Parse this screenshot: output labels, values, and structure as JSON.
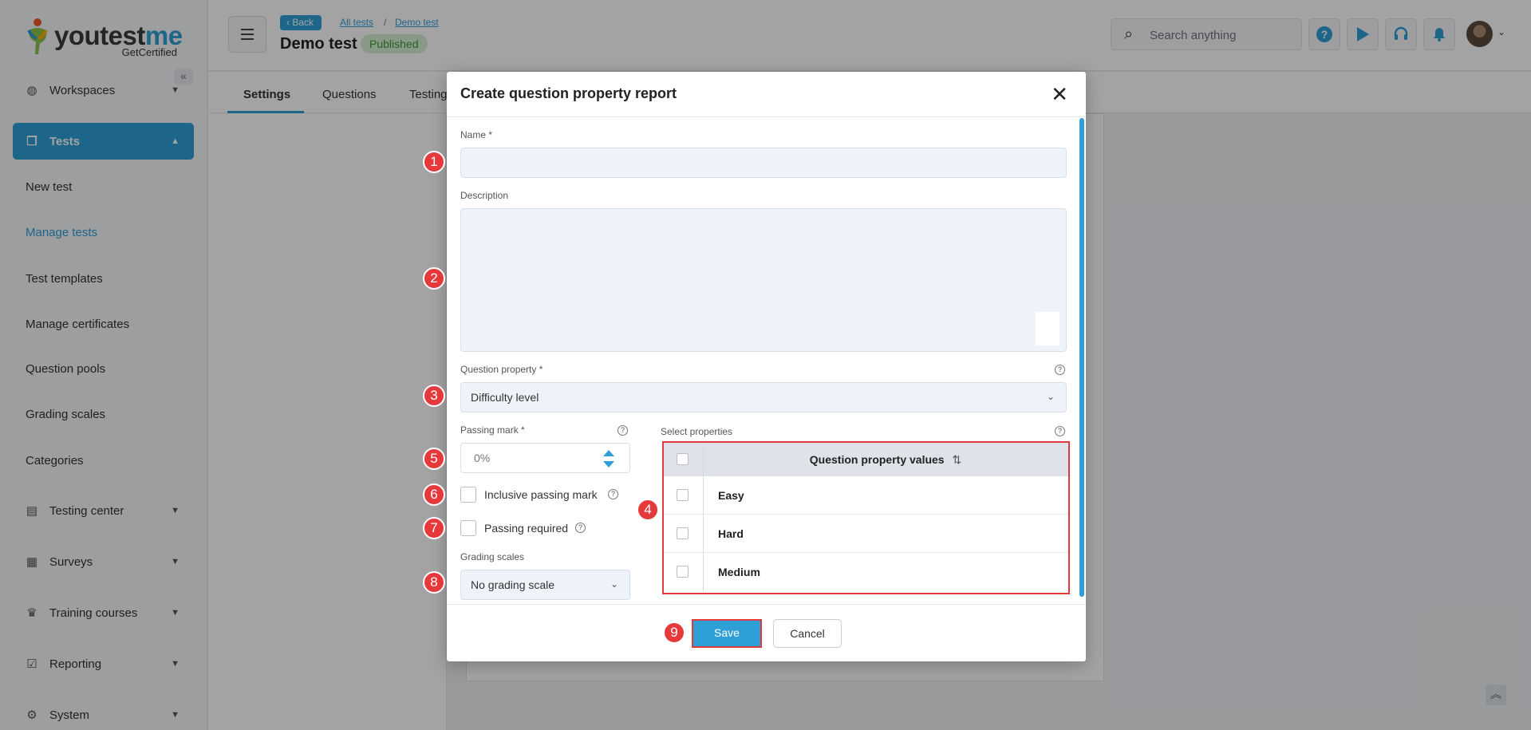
{
  "brand": {
    "logo_text_main": "youtest",
    "logo_text_me": "me",
    "logo_sub": "GetCertified"
  },
  "sidebar": {
    "collapse_label": "«",
    "items": [
      {
        "label": "Workspaces",
        "icon": "globe-icon"
      },
      {
        "label": "Tests",
        "icon": "copy-icon"
      },
      {
        "label": "Testing center",
        "icon": "monitor-icon"
      },
      {
        "label": "Surveys",
        "icon": "list-icon"
      },
      {
        "label": "Training courses",
        "icon": "trophy-icon"
      },
      {
        "label": "Reporting",
        "icon": "checkbox-icon"
      },
      {
        "label": "System",
        "icon": "gear-icon"
      }
    ],
    "sub_items": [
      "New test",
      "Manage tests",
      "Test templates",
      "Manage certificates",
      "Question pools",
      "Grading scales",
      "Categories"
    ]
  },
  "header": {
    "back_label": "Back",
    "breadcrumb": [
      "All tests",
      "Demo test"
    ],
    "breadcrumb_sep": "/",
    "title": "Demo test",
    "status": "Published",
    "search_placeholder": "Search anything"
  },
  "tabs": [
    "Settings",
    "Questions",
    "Testing"
  ],
  "modal": {
    "title": "Create question property report",
    "name_label": "Name *",
    "name_value": "",
    "description_label": "Description",
    "description_value": "",
    "question_property_label": "Question property *",
    "question_property_value": "Difficulty level",
    "passing_mark_label": "Passing mark *",
    "passing_mark_value": "0%",
    "inclusive_label": "Inclusive passing mark",
    "passing_required_label": "Passing required",
    "grading_scales_label": "Grading scales",
    "grading_scales_value": "No grading scale",
    "select_properties_label": "Select properties",
    "table_header": "Question property values",
    "table_rows": [
      "Easy",
      "Hard",
      "Medium"
    ],
    "save_label": "Save",
    "cancel_label": "Cancel"
  },
  "annotations": [
    "1",
    "2",
    "3",
    "4",
    "5",
    "6",
    "7",
    "8",
    "9"
  ],
  "colors": {
    "accent": "#2f9fd8",
    "highlight": "#e03a3a",
    "published_bg": "#d6f0d4",
    "published_text": "#3a9a3a"
  }
}
